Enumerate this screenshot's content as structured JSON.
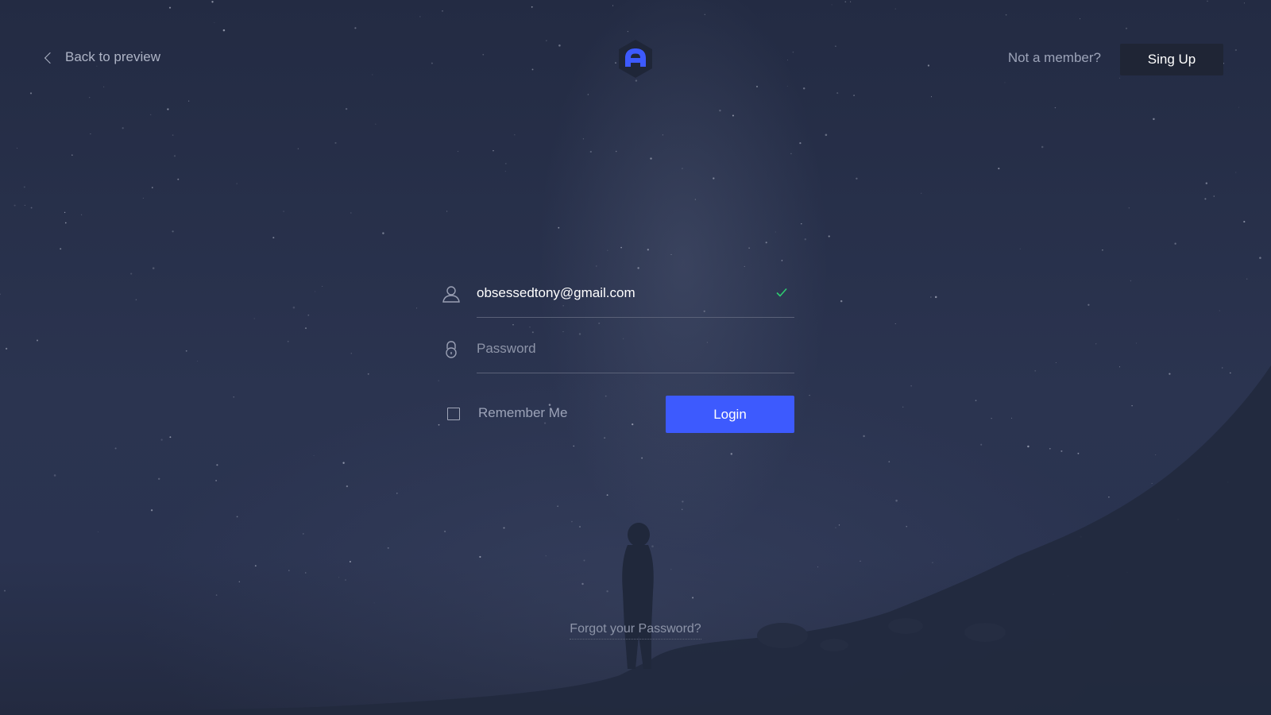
{
  "header": {
    "back_label": "Back to preview",
    "not_member_text": "Not a member?",
    "signup_label": "Sing Up"
  },
  "form": {
    "email_value": "obsessedtony@gmail.com",
    "email_valid": true,
    "password_placeholder": "Password",
    "password_value": "",
    "remember_label": "Remember Me",
    "remember_checked": false,
    "login_label": "Login"
  },
  "footer": {
    "forgot_label": "Forgot your Password?"
  },
  "colors": {
    "accent": "#3d5afe",
    "valid": "#2ecc71",
    "background": "#27304a"
  },
  "icons": [
    "chevron-left-icon",
    "logo-icon",
    "user-icon",
    "check-icon",
    "lock-icon"
  ]
}
